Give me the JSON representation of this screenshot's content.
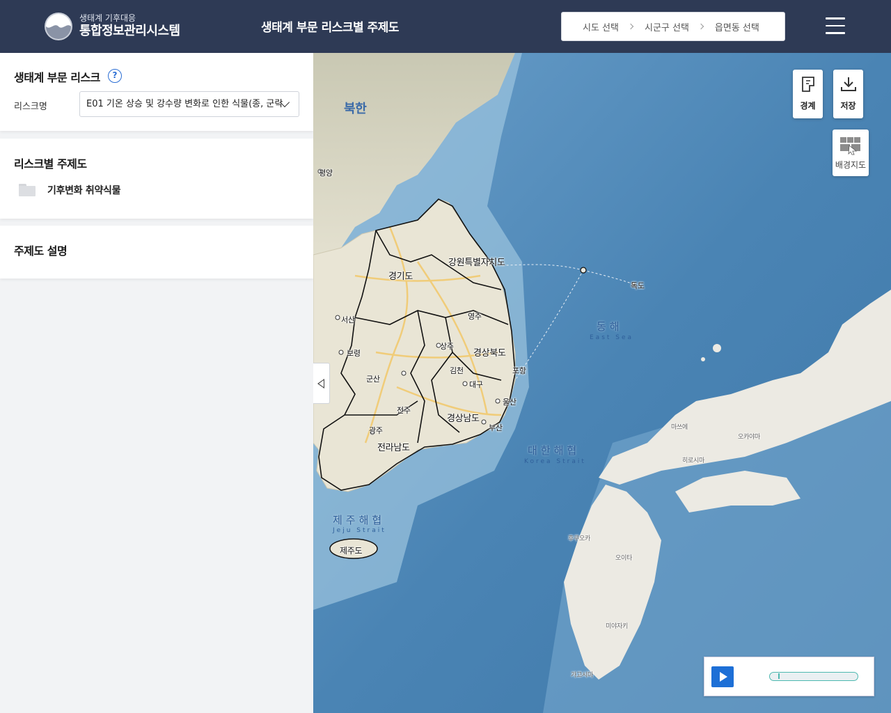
{
  "header": {
    "logo_sub": "생태계 기후대응",
    "logo_main": "통합정보관리시스템",
    "title": "생태계 부문 리스크별 주제도",
    "region": [
      "시도 선택",
      "시군구 선택",
      "읍면동 선택"
    ]
  },
  "risk": {
    "title": "생태계 부문 리스크",
    "help": "?",
    "label": "리스크명",
    "selected": "E01 기온 상승 및 강수량 변화로 인한 식물(종, 군락"
  },
  "thematic": {
    "title": "리스크별 주제도",
    "folder": "기후변화 취약식물"
  },
  "description": {
    "title": "주제도 설명"
  },
  "map": {
    "tools": {
      "boundary": "경계",
      "save": "저장",
      "basemap": "배경지도"
    },
    "regions": [
      "강원특별자치도",
      "경기도",
      "경상북도",
      "경상남도",
      "전라남도",
      "제주도",
      "북한"
    ],
    "cities": [
      "평양",
      "대구",
      "울산",
      "부산",
      "광주",
      "군산",
      "전주",
      "서산",
      "보령",
      "영주",
      "상주",
      "김천",
      "포항",
      "독도"
    ],
    "seas": [
      {
        "name": "동해",
        "sub": "East Sea"
      },
      {
        "name": "대한해협",
        "sub": "Korea Strait"
      },
      {
        "name": "제주해협",
        "sub": "Jeju Strait"
      }
    ],
    "japan_labels": [
      "오카야마",
      "히로시마",
      "후쿠오카",
      "가고시마",
      "미야자키",
      "오이타",
      "마쓰에"
    ]
  },
  "colors": {
    "header_bg": "#2e3a55",
    "accent": "#1d6fd6",
    "sea": "#4b86b6",
    "land": "#e8e4d6"
  }
}
